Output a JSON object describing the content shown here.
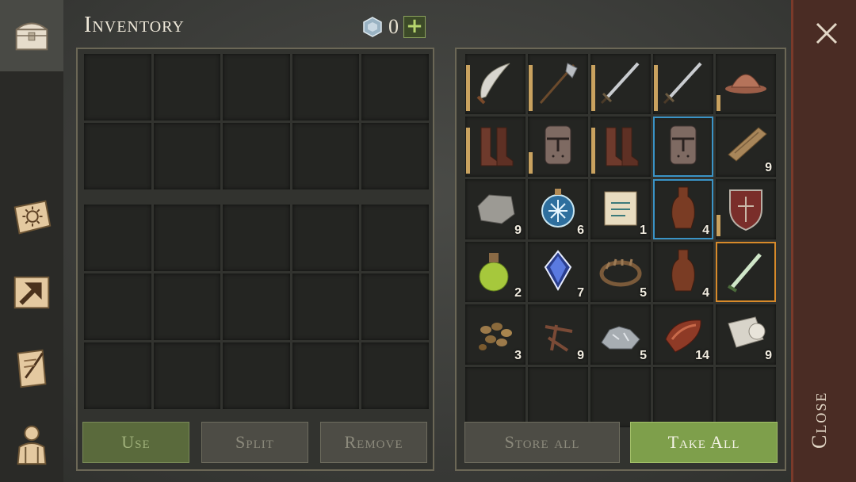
{
  "header": {
    "title": "Inventory",
    "gem_count": "0",
    "plus_label": "+"
  },
  "sidebar": {
    "tabs": [
      {
        "name": "chest-icon",
        "active": true
      },
      {
        "name": "sun-book-icon"
      },
      {
        "name": "crafting-arrow-icon"
      },
      {
        "name": "quest-scroll-icon"
      },
      {
        "name": "character-icon"
      }
    ]
  },
  "buttons": {
    "use": "Use",
    "split": "Split",
    "remove": "Remove",
    "store_all": "Store all",
    "take_all": "Take All"
  },
  "close": {
    "label": "Close"
  },
  "loot": [
    {
      "icon": "scimitar-icon",
      "count": "",
      "durability": 0.85
    },
    {
      "icon": "halberd-icon",
      "count": "",
      "durability": 0.85
    },
    {
      "icon": "sword-icon",
      "count": "",
      "durability": 0.85
    },
    {
      "icon": "sword-icon",
      "count": "",
      "durability": 0.85
    },
    {
      "icon": "helmet-icon",
      "count": "",
      "durability": 0.3
    },
    {
      "icon": "boots-icon",
      "count": "",
      "durability": 0.85
    },
    {
      "icon": "great-helm-icon",
      "count": "",
      "durability": 0.4
    },
    {
      "icon": "boots-icon",
      "count": "",
      "durability": 0.85
    },
    {
      "icon": "great-helm-icon",
      "count": "",
      "durability": 0,
      "highlight": "blue"
    },
    {
      "icon": "wood-plank-icon",
      "count": "9"
    },
    {
      "icon": "stone-icon",
      "count": "9"
    },
    {
      "icon": "frost-potion-icon",
      "count": "6"
    },
    {
      "icon": "scroll-icon",
      "count": "1"
    },
    {
      "icon": "bottle-icon",
      "count": "4",
      "highlight": "blue"
    },
    {
      "icon": "shield-icon",
      "count": "",
      "durability": 0.4
    },
    {
      "icon": "green-potion-icon",
      "count": "2"
    },
    {
      "icon": "crystal-icon",
      "count": "7"
    },
    {
      "icon": "bear-trap-icon",
      "count": "5"
    },
    {
      "icon": "bottle-icon",
      "count": "4"
    },
    {
      "icon": "dagger-icon",
      "count": "",
      "highlight": "orange"
    },
    {
      "icon": "seeds-icon",
      "count": "3"
    },
    {
      "icon": "nails-icon",
      "count": "9"
    },
    {
      "icon": "ore-icon",
      "count": "5"
    },
    {
      "icon": "meat-icon",
      "count": "14"
    },
    {
      "icon": "cloth-roll-icon",
      "count": "9"
    }
  ]
}
